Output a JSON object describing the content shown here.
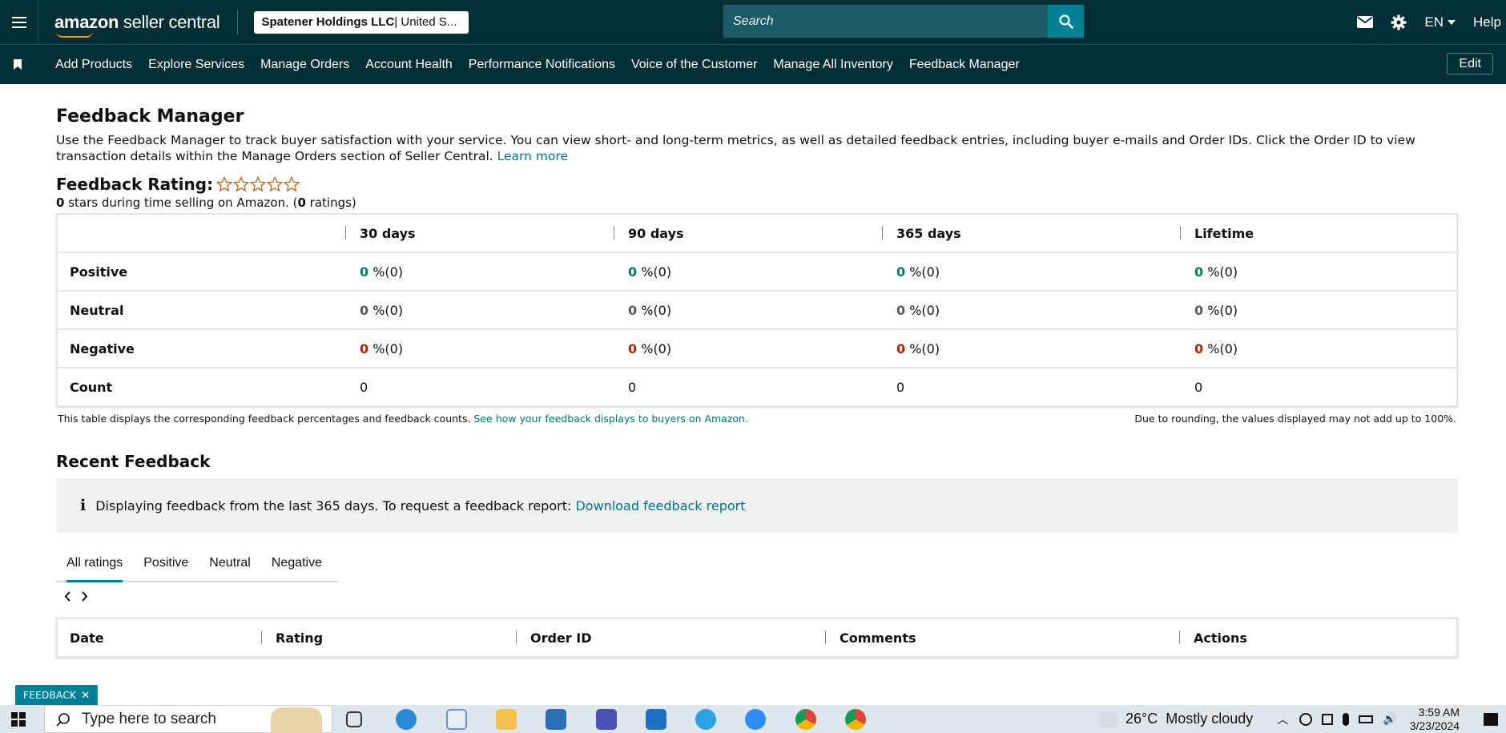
{
  "header": {
    "logo_main": "amazon",
    "logo_sub": " seller central",
    "account_name": "Spatener Holdings LLC",
    "account_region": " | United S...",
    "search_placeholder": "Search",
    "language": "EN",
    "help": "Help"
  },
  "nav": {
    "links": [
      "Add Products",
      "Explore Services",
      "Manage Orders",
      "Account Health",
      "Performance Notifications",
      "Voice of the Customer",
      "Manage All Inventory",
      "Feedback Manager"
    ],
    "edit": "Edit"
  },
  "page": {
    "title": "Feedback Manager",
    "intro": "Use the Feedback Manager to track buyer satisfaction with your service. You can view short- and long-term metrics, as well as detailed feedback entries, including buyer e-mails and Order IDs. Click the Order ID to view transaction details within the Manage Orders section of Seller Central.",
    "learn_more": "Learn more",
    "rating_label": "Feedback Rating:",
    "rating_stars": 0,
    "rating_sub_stars": "0",
    "rating_sub_text": " stars during time selling on Amazon. (",
    "rating_sub_count": "0",
    "rating_sub_end": " ratings)"
  },
  "summary_table": {
    "columns": [
      "30 days",
      "90 days",
      "365 days",
      "Lifetime"
    ],
    "rows": [
      {
        "label": "Positive",
        "cells": [
          {
            "v": "0",
            "p": " %(0)"
          },
          {
            "v": "0",
            "p": " %(0)"
          },
          {
            "v": "0",
            "p": " %(0)"
          },
          {
            "v": "0",
            "p": " %(0)"
          }
        ]
      },
      {
        "label": "Neutral",
        "cells": [
          {
            "v": "0",
            "p": " %(0)"
          },
          {
            "v": "0",
            "p": " %(0)"
          },
          {
            "v": "0",
            "p": " %(0)"
          },
          {
            "v": "0",
            "p": " %(0)"
          }
        ]
      },
      {
        "label": "Negative",
        "cells": [
          {
            "v": "0",
            "p": " %(0)"
          },
          {
            "v": "0",
            "p": " %(0)"
          },
          {
            "v": "0",
            "p": " %(0)"
          },
          {
            "v": "0",
            "p": " %(0)"
          }
        ]
      },
      {
        "label": "Count",
        "cells": [
          "0",
          "0",
          "0",
          "0"
        ]
      }
    ],
    "footnote_left": "This table displays the corresponding feedback percentages and feedback counts.",
    "footnote_link": "See how your feedback displays to buyers on Amazon.",
    "footnote_right": "Due to rounding, the values displayed may not add up to 100%."
  },
  "recent": {
    "title": "Recent Feedback",
    "info_icon": "i",
    "info_text": "Displaying feedback from the last 365 days. To request a feedback report:",
    "info_link": "Download feedback report",
    "tabs": [
      "All ratings",
      "Positive",
      "Neutral",
      "Negative"
    ],
    "active_tab": "All ratings",
    "columns": [
      "Date",
      "Rating",
      "Order ID",
      "Comments",
      "Actions"
    ]
  },
  "feedback_tag": "FEEDBACK",
  "taskbar": {
    "search_placeholder": "Type here to search",
    "weather": "26°C  Mostly cloudy",
    "time": "3:59 AM",
    "date": "3/23/2024"
  },
  "colors": {
    "header_bg": "#002f36",
    "accent": "#008296",
    "positive": "#067d62",
    "negative": "#b12704",
    "link": "#007185"
  }
}
